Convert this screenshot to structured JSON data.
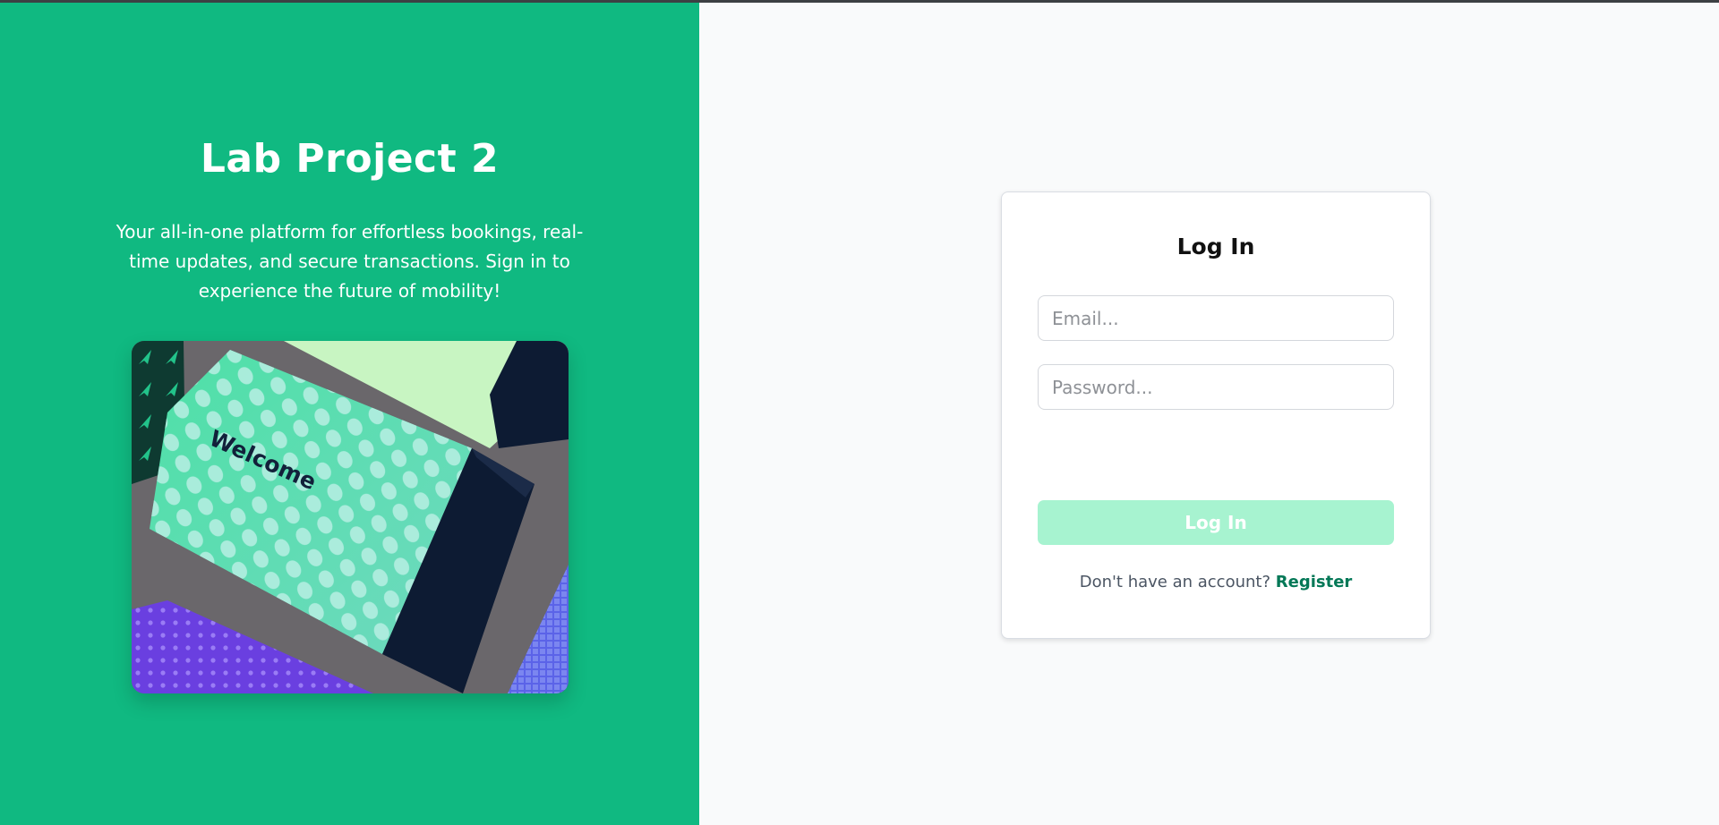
{
  "brand": {
    "title": "Lab Project 2",
    "tagline": "Your all-in-one platform for effortless bookings, real-time updates, and secure transactions. Sign in to experience the future of mobility!",
    "hero_image_text": "Welcome",
    "panel_color": "#10b981"
  },
  "login": {
    "heading": "Log In",
    "email_placeholder": "Email...",
    "password_placeholder": "Password...",
    "submit_label": "Log In",
    "submit_color": "#a7f3d0",
    "register_prompt": "Don't have an account?",
    "register_link": "Register",
    "link_color": "#047857"
  }
}
